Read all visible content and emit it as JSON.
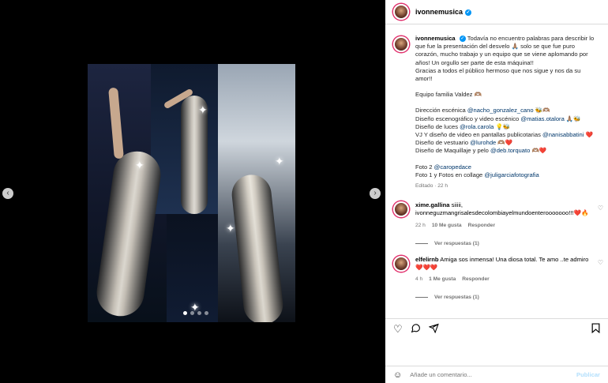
{
  "post": {
    "username": "ivonnemusica",
    "verified_mark": "✓"
  },
  "media": {
    "prev_icon": "‹",
    "next_icon": "›",
    "dots_total": 4,
    "dots_active": 0
  },
  "caption": {
    "username": "ivonnemusica",
    "lines": [
      "Todavía no encuentro palabras para describir lo",
      "que fue la presentación del desvelo 🙏🏽 solo se que fue puro",
      "corazón, mucho trabajo y un equipo que se viene aplomando por",
      "años! Un orgullo ser parte de esta máquina!!",
      "Gracias a todos el público hermoso que nos sigue y nos da su",
      "amor!!"
    ],
    "team": "Equipo familia Valdez 🫶🏽",
    "credits": [
      {
        "label": "Dirección escénica ",
        "mention": "@nacho_gonzalez_cano",
        "suffix": " 🐝🫶🏽"
      },
      {
        "label": "Diseño escenográfico y video escénico ",
        "mention": "@matias.otalora",
        "suffix": " 🙏🏽🐝"
      },
      {
        "label": "Diseño de luces ",
        "mention": "@rola.carola",
        "suffix": " 💡🐝"
      },
      {
        "label": "VJ Y diseño de video en pantallas publicotarias ",
        "mention": "@nanisabbatini",
        "suffix": " ❤️"
      },
      {
        "label": "Diseño de vestuario ",
        "mention": "@lurohde",
        "suffix": " 🫶🏽❤️"
      },
      {
        "label": "Diseño de Maquillaje y pelo ",
        "mention": "@deb.torquato",
        "suffix": " 🫶🏽❤️"
      }
    ],
    "photos": [
      {
        "label": "Foto 2 ",
        "mention": "@caropedace"
      },
      {
        "label": "Foto 1 y Fotos en collage ",
        "mention": "@juligarciafotografia"
      }
    ],
    "edited": "Editado · 22 h"
  },
  "comments": [
    {
      "username": "xime.gallina",
      "text": "siiiii, ivonneguzmangrisalesdecolombiayelmundoenterooooooo!!!❤️🔥",
      "time": "22 h",
      "likes": "10 Me gusta",
      "reply": "Responder",
      "view_replies": "Ver respuestas (1)"
    },
    {
      "username": "elfelirnb",
      "text": "Amiga sos inmensa! Una diosa total. Te amo ..te admiro ❤️❤️❤️",
      "time": "4 h",
      "likes": "1 Me gusta",
      "reply": "Responder",
      "view_replies": "Ver respuestas (1)"
    }
  ],
  "actions": {
    "like_icon": "heart-icon",
    "comment_icon": "comment-icon",
    "share_icon": "share-icon",
    "save_icon": "bookmark-icon"
  },
  "add_comment": {
    "placeholder": "Añade un comentario...",
    "publish": "Publicar"
  },
  "colors": {
    "link": "#00376b",
    "verified": "#0095f6",
    "muted": "#737373",
    "publish_disabled": "#b2dffc"
  }
}
